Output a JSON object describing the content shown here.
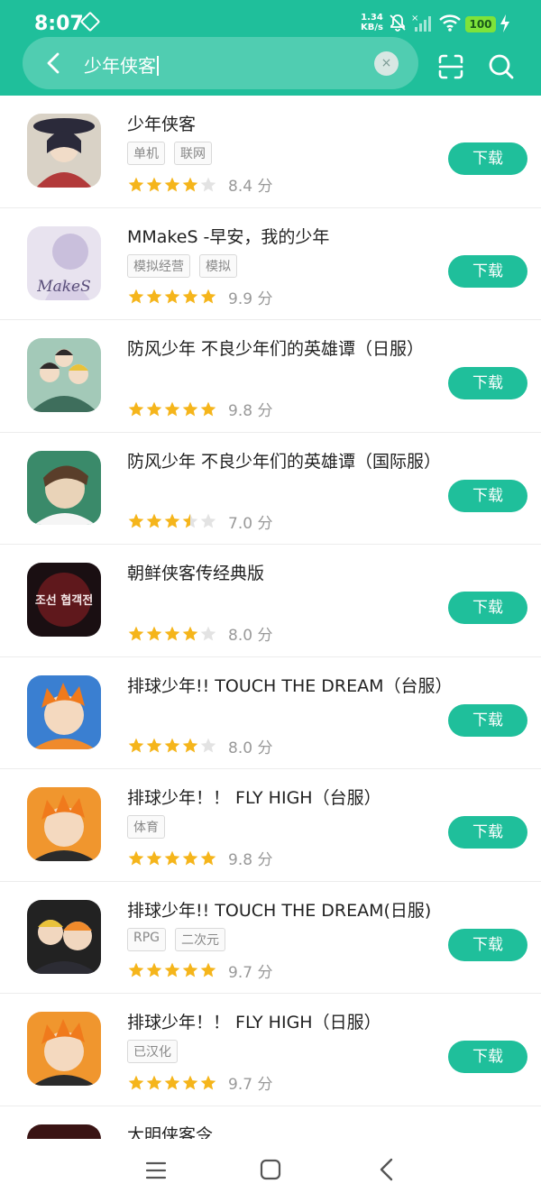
{
  "status_bar": {
    "time": "8:07",
    "net_speed_value": "1.34",
    "net_speed_unit": "KB/s",
    "battery": "100"
  },
  "search": {
    "query": "少年侠客",
    "clear_symbol": "×"
  },
  "results": [
    {
      "name": "少年侠客",
      "tags": [
        "单机",
        "联网"
      ],
      "rating": 4,
      "score": "8.4 分",
      "button": "下载",
      "icon": "wuxia-portrait",
      "icon_colors": [
        "#2b2a3a",
        "#b23a3a"
      ]
    },
    {
      "name": "MMakeS -早安，我的少年",
      "tags": [
        "模拟经营",
        "模拟"
      ],
      "rating": 5,
      "score": "9.9 分",
      "button": "下载",
      "icon": "makes-logo",
      "icon_colors": [
        "#e8e3ef",
        "#c9bfdc"
      ],
      "icon_text": "MakeS"
    },
    {
      "name": "防风少年 不良少年们的英雄谭（日服）",
      "tags": [],
      "rating": 5,
      "score": "9.8 分",
      "button": "下载",
      "icon": "anime-group",
      "icon_colors": [
        "#3e6e5c",
        "#a3c9b8"
      ]
    },
    {
      "name": "防风少年 不良少年们的英雄谭（国际服）",
      "tags": [],
      "rating": 3.5,
      "score": "7.0 分",
      "button": "下载",
      "icon": "anime-boy",
      "icon_colors": [
        "#3a8a6a",
        "#e9d3b8"
      ]
    },
    {
      "name": "朝鲜侠客传经典版",
      "tags": [],
      "rating": 4,
      "score": "8.0 分",
      "button": "下载",
      "icon": "hangul-logo",
      "icon_colors": [
        "#1a0f12",
        "#b3232a"
      ],
      "icon_text": "조선 협객전"
    },
    {
      "name": "排球少年!! TOUCH THE DREAM（台服）",
      "tags": [],
      "rating": 4,
      "score": "8.0 分",
      "button": "下载",
      "icon": "volleyball-boy",
      "icon_colors": [
        "#3a7fd1",
        "#f08a2b"
      ]
    },
    {
      "name": "排球少年！！ FLY HIGH（台服）",
      "tags": [
        "体育"
      ],
      "rating": 5,
      "score": "9.8 分",
      "button": "下载",
      "icon": "volleyball-boy",
      "icon_colors": [
        "#f0962e",
        "#2b2b2b"
      ]
    },
    {
      "name": "排球少年!! TOUCH THE DREAM(日服)",
      "tags": [
        "RPG",
        "二次元"
      ],
      "rating": 5,
      "score": "9.7 分",
      "button": "下载",
      "icon": "volleyball-duo",
      "icon_colors": [
        "#222222",
        "#f08a2b"
      ]
    },
    {
      "name": "排球少年！！ FLY HIGH（日服）",
      "tags": [
        "已汉化"
      ],
      "rating": 5,
      "score": "9.7 分",
      "button": "下载",
      "icon": "volleyball-boy",
      "icon_colors": [
        "#f0962e",
        "#2b2b2b"
      ]
    },
    {
      "name": "大明侠客令",
      "tags": [],
      "rating": 0,
      "score": "",
      "button": "",
      "icon": "ming-art",
      "icon_colors": [
        "#3a1414",
        "#8c2a2a"
      ]
    }
  ],
  "colors": {
    "accent": "#1fbf9b",
    "star_on": "#f5b51b",
    "star_off": "#e3e3e3"
  }
}
